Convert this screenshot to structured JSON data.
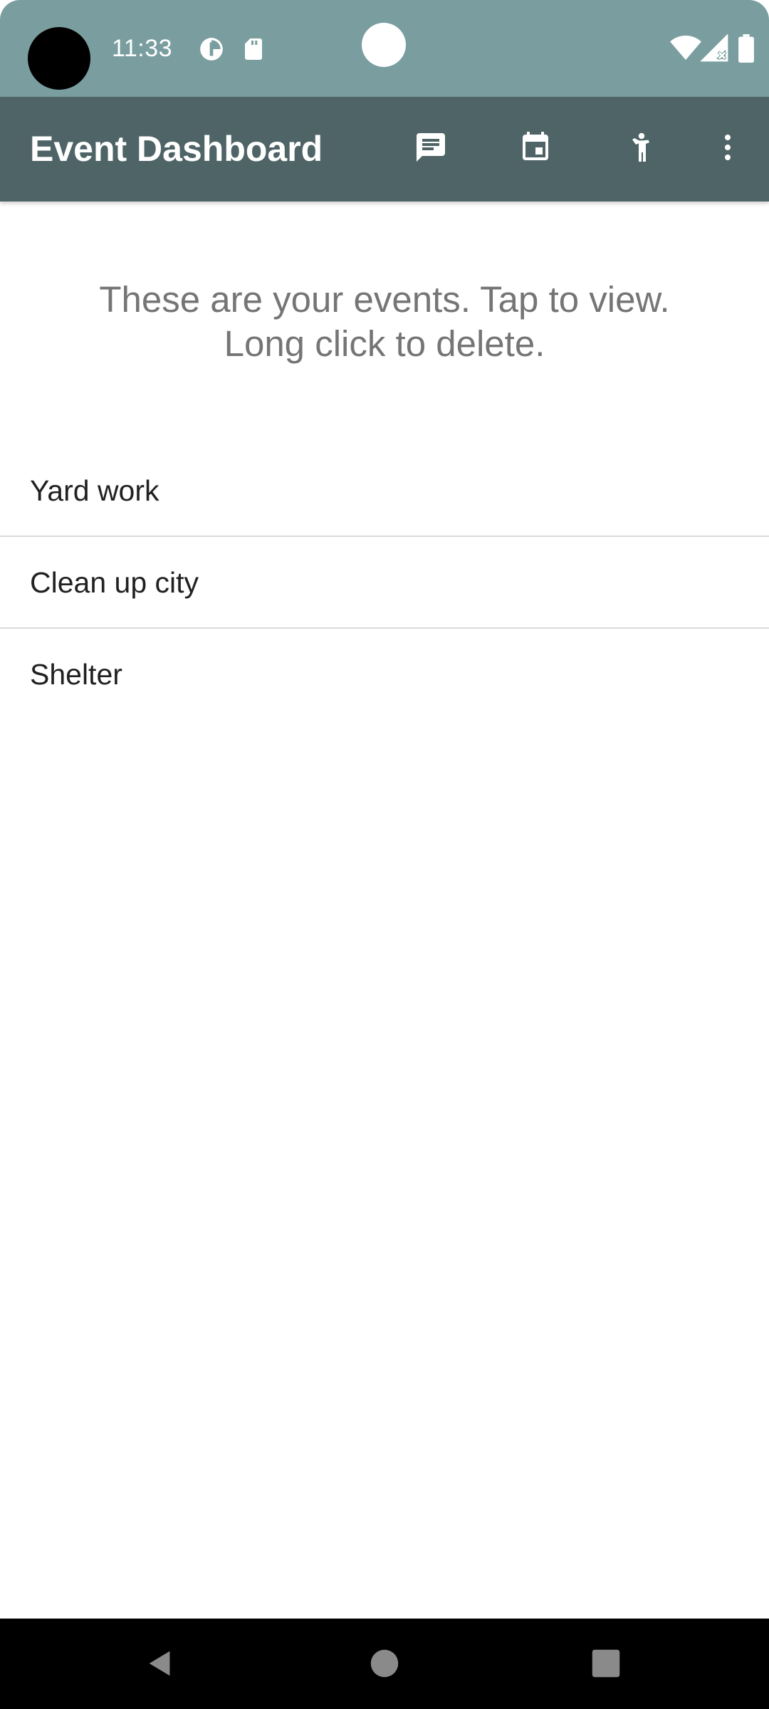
{
  "status_bar": {
    "time": "11:33",
    "background_color": "#7a9e9f",
    "icons": [
      "data-saver-icon",
      "sd-card-icon",
      "wifi-icon",
      "cellular-no-signal-icon",
      "battery-icon"
    ]
  },
  "app_bar": {
    "title": "Event Dashboard",
    "background_color": "#4f6466",
    "actions": [
      {
        "name": "message-icon"
      },
      {
        "name": "calendar-icon"
      },
      {
        "name": "volunteer-person-icon"
      },
      {
        "name": "overflow-menu-icon"
      }
    ]
  },
  "main": {
    "instructions_line1": "These are your events. Tap to view.",
    "instructions_line2": "Long click to delete.",
    "events": [
      {
        "label": "Yard work"
      },
      {
        "label": "Clean up city"
      },
      {
        "label": "Shelter"
      }
    ]
  },
  "nav_bar": {
    "buttons": [
      "back-icon",
      "home-icon",
      "recents-icon"
    ]
  }
}
